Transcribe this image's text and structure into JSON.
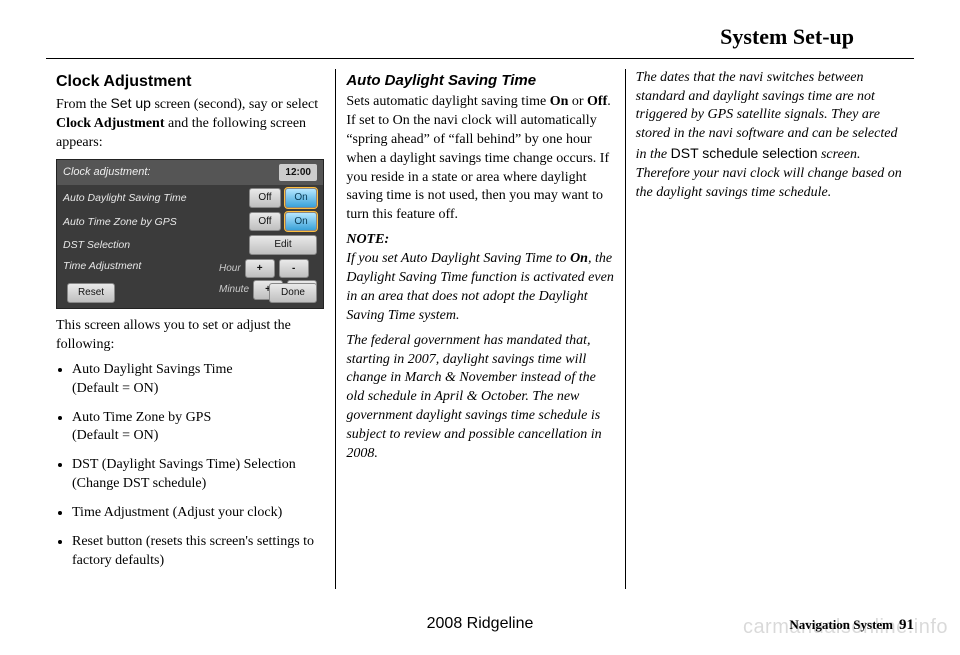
{
  "header": {
    "title": "System Set-up"
  },
  "col1": {
    "heading": "Clock Adjustment",
    "intro_pre": "From the ",
    "intro_app": "Set up",
    "intro_mid": " screen (second), say or select ",
    "intro_bold": "Clock Adjustment",
    "intro_post": " and the following screen appears:",
    "shot": {
      "title": "Clock adjustment:",
      "clock": "12:00",
      "r1": {
        "label": "Auto Daylight Saving Time",
        "off": "Off",
        "on": "On"
      },
      "r2": {
        "label": "Auto Time Zone by GPS",
        "off": "Off",
        "on": "On"
      },
      "r3": {
        "label": "DST Selection",
        "btn": "Edit"
      },
      "r4": {
        "label": "Time Adjustment",
        "sub1": "Hour",
        "sub2": "Minute",
        "plus": "+",
        "minus": "-"
      },
      "reset": "Reset",
      "done": "Done"
    },
    "after_shot": "This screen allows you to set or adjust the following:",
    "bullets": [
      {
        "a": "Auto Daylight Savings Time",
        "b": "(Default = ON)"
      },
      {
        "a": "Auto Time Zone by GPS",
        "b": "(Default = ON)"
      },
      {
        "a": "DST (Daylight Savings Time) Selection",
        "b": "(Change DST schedule)"
      },
      {
        "a": "Time Adjustment (Adjust your clock)",
        "b": ""
      },
      {
        "a": "Reset button (resets this screen's settings to factory defaults)",
        "b": ""
      }
    ]
  },
  "col2": {
    "heading": "Auto Daylight Saving Time",
    "para1_a": "Sets automatic daylight saving time ",
    "para1_on": "On",
    "para1_b": " or ",
    "para1_off": "Off",
    "para1_c": ". If set to On the navi clock will automatically “spring ahead” of “fall behind” by one hour when a daylight savings time change occurs. If you reside in a state or area where daylight saving time is not used, then you may want to turn this feature off.",
    "note_label": "NOTE:",
    "note_a": "If you set Auto Daylight Saving Time to ",
    "note_on": "On",
    "note_b": ", the Daylight Saving Time function is activated even in an area that does not adopt the Daylight Saving Time system.",
    "para2": "The federal government has mandated that, starting in 2007, daylight savings time will change in March & November instead of the old schedule in April & October. The new government daylight savings time schedule is subject to review and possible cancellation in 2008."
  },
  "col3": {
    "para_a": "The dates that the navi switches between standard and daylight savings time are not triggered by GPS satellite signals. They are stored in the navi software and can be selected in the ",
    "para_app": "DST schedule selection",
    "para_b": " screen. Therefore your navi clock will change based on the daylight savings time schedule."
  },
  "footer": {
    "model": "2008  Ridgeline",
    "section": "Navigation System",
    "page": "91",
    "watermark": "carmanualsonline.info"
  }
}
